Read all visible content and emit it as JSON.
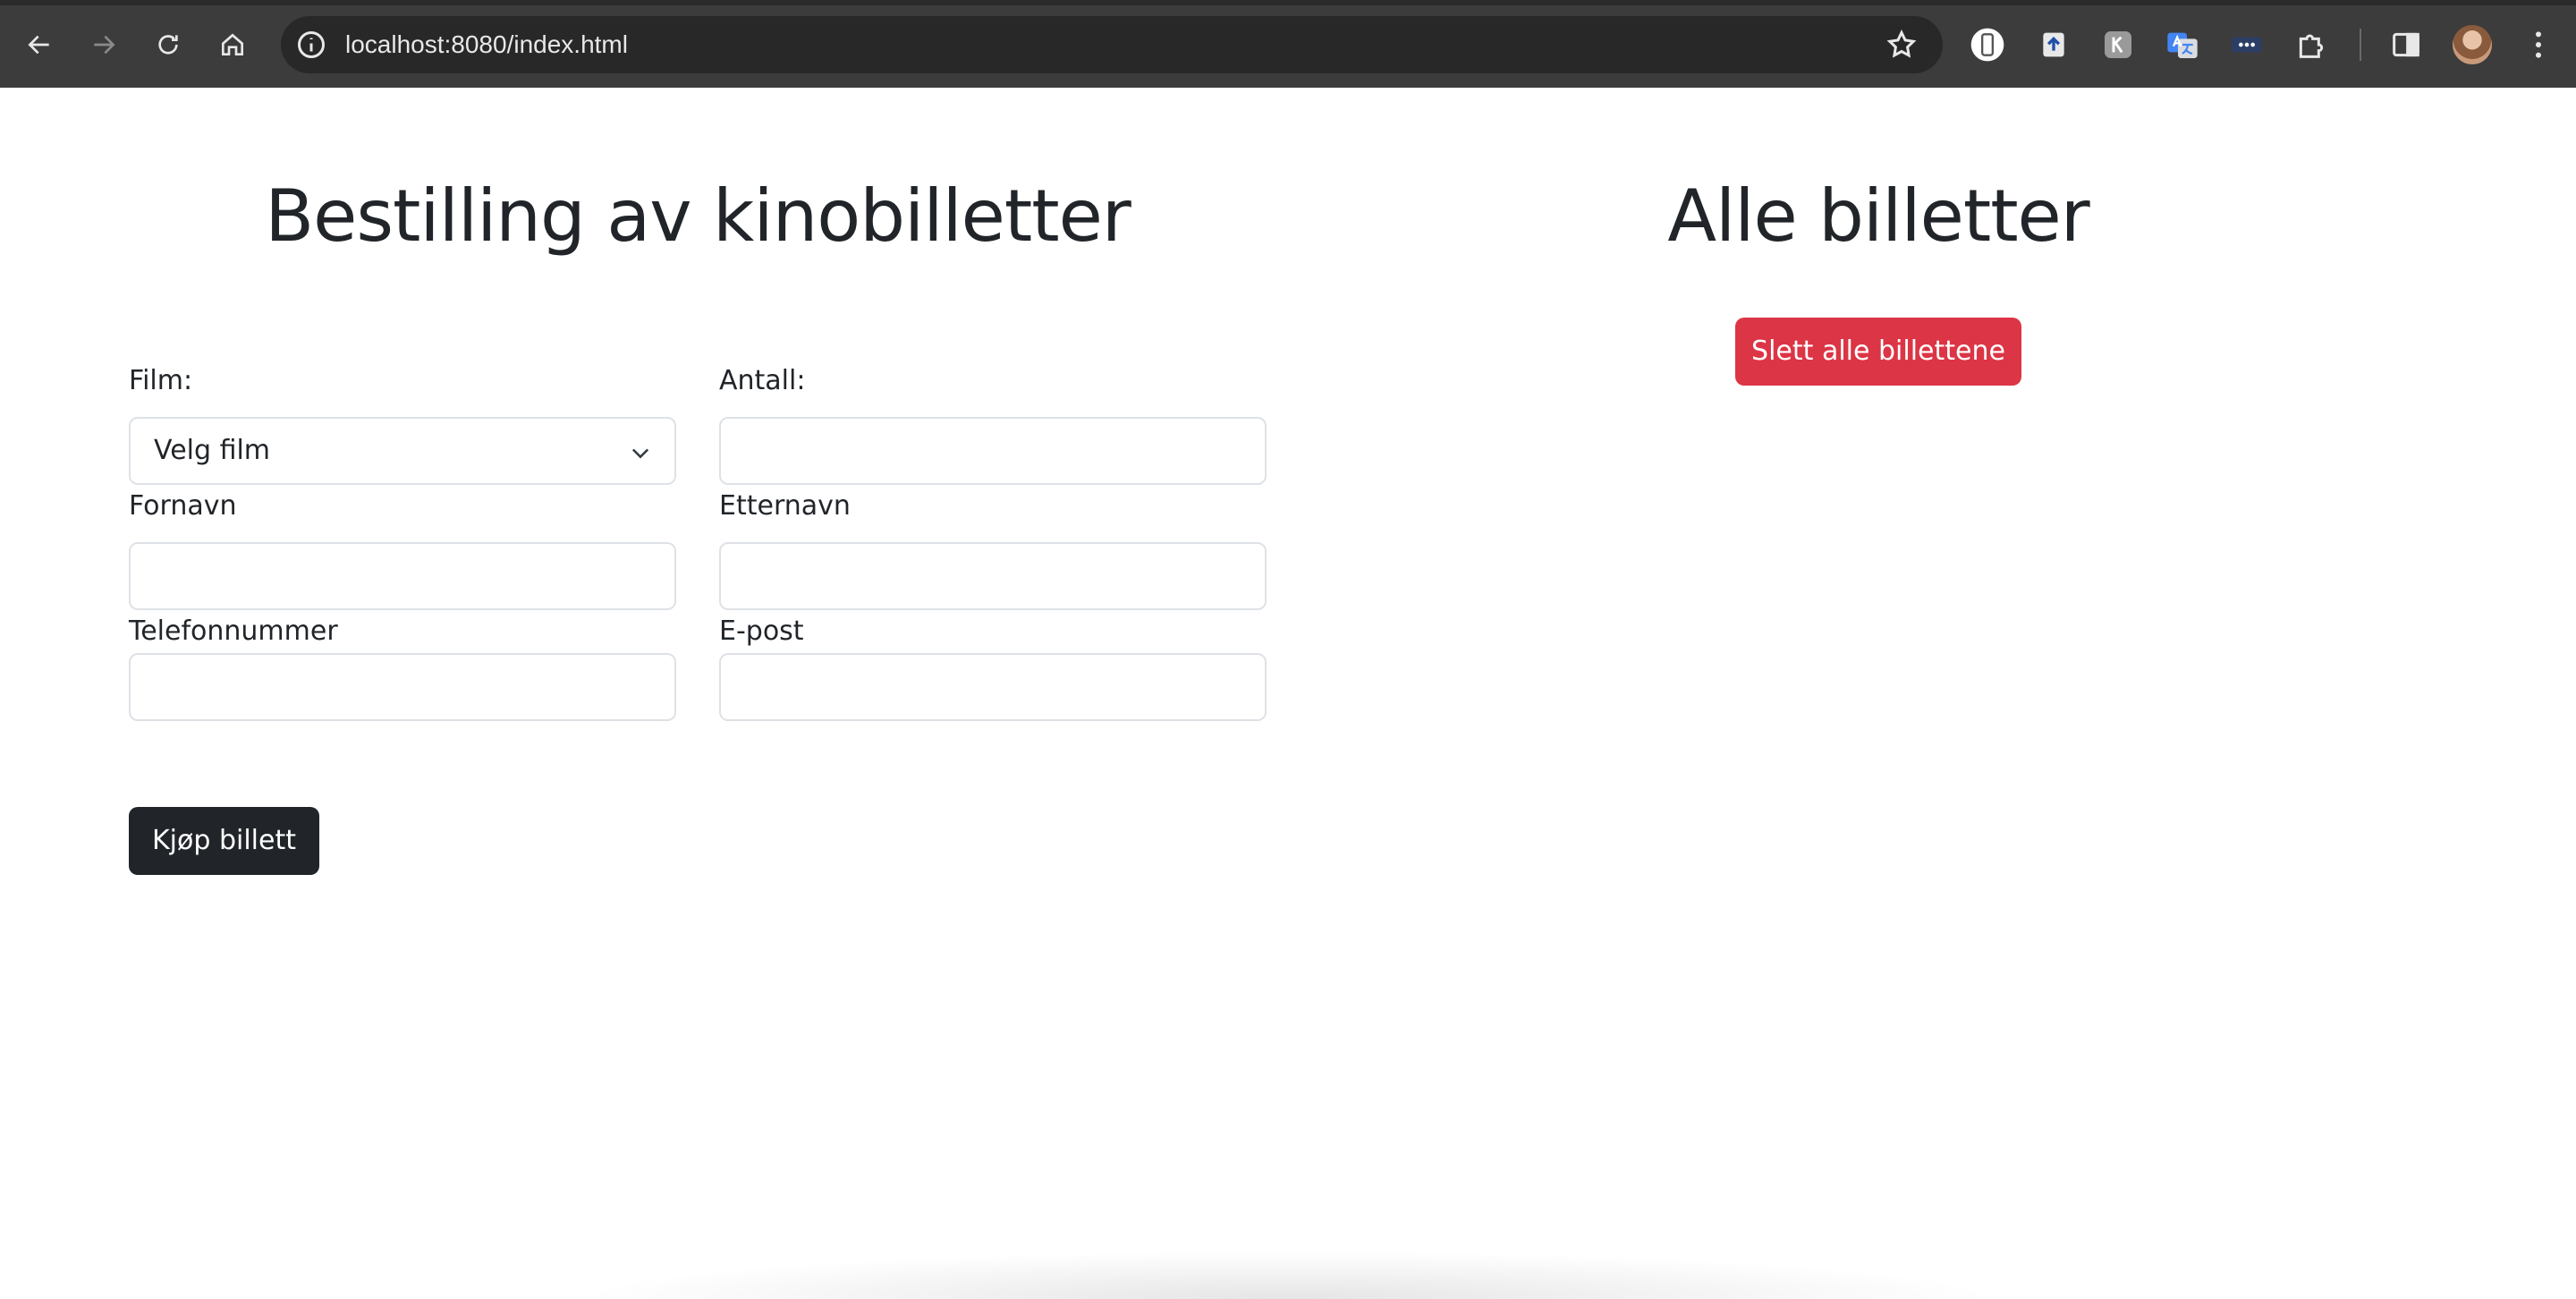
{
  "browser": {
    "url": "localhost:8080/index.html",
    "icons": {
      "back": "back-arrow-icon",
      "forward": "forward-arrow-icon",
      "reload": "reload-icon",
      "home": "home-icon",
      "info": "info-icon",
      "bookmark": "star-icon",
      "extensions": [
        "phone-frame-icon",
        "upload-icon",
        "translate-k-icon",
        "google-translate-icon",
        "password-dots-icon",
        "puzzle-icon"
      ],
      "side_panel": "side-panel-icon",
      "menu": "kebab-menu-icon"
    }
  },
  "order_form": {
    "title": "Bestilling av kinobilletter",
    "film_label": "Film:",
    "film_select_value": "Velg film",
    "antall_label": "Antall:",
    "antall_value": "",
    "fornavn_label": "Fornavn",
    "fornavn_value": "",
    "etternavn_label": "Etternavn",
    "etternavn_value": "",
    "telefon_label": "Telefonnummer",
    "telefon_value": "",
    "epost_label": "E-post",
    "epost_value": "",
    "buy_button": "Kjøp billett"
  },
  "tickets": {
    "title": "Alle billetter",
    "delete_all_button": "Slett alle billettene"
  },
  "colors": {
    "primary_dark": "#212529",
    "danger": "#dc3545",
    "chrome_bg": "#3c3c3c"
  }
}
